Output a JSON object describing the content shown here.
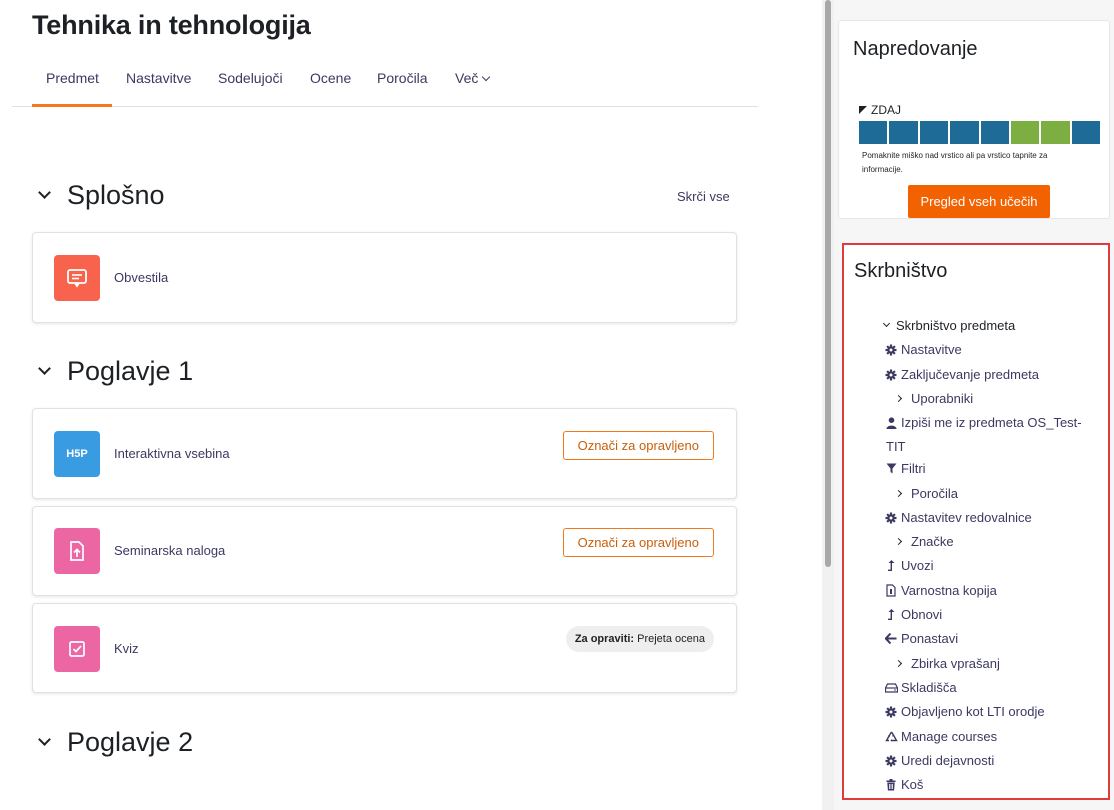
{
  "course": {
    "title": "Tehnika in tehnologija"
  },
  "tabs": [
    {
      "label": "Predmet",
      "active": true
    },
    {
      "label": "Nastavitve"
    },
    {
      "label": "Sodelujoči"
    },
    {
      "label": "Ocene"
    },
    {
      "label": "Poročila"
    },
    {
      "label": "Več"
    }
  ],
  "collapse_all": "Skrči vse",
  "sections": [
    {
      "title": "Splošno"
    },
    {
      "title": "Poglavje 1"
    },
    {
      "title": "Poglavje 2"
    }
  ],
  "activities": [
    {
      "name": "Obvestila",
      "icon": "forum-icon",
      "color": "#f7634d"
    },
    {
      "name": "Interaktivna vsebina",
      "icon": "h5p-icon",
      "color": "#399be2",
      "icon_text": "H5P",
      "action": "Označi za opravljeno"
    },
    {
      "name": "Seminarska naloga",
      "icon": "assignment-upload-icon",
      "color": "#eb66a2",
      "action": "Označi za opravljeno"
    },
    {
      "name": "Kviz",
      "icon": "quiz-check-icon",
      "color": "#eb66a2",
      "todo_label": "Za opraviti:",
      "todo_value": "Prejeta ocena"
    }
  ],
  "progress_block": {
    "title": "Napredovanje",
    "now_label": "ZDAJ",
    "cells": [
      "pending",
      "pending",
      "pending",
      "pending",
      "pending",
      "done",
      "done",
      "pending"
    ],
    "colors": {
      "pending": "#1f6b98",
      "done": "#7cae42"
    },
    "hint": "Pomaknite miško nad vrstico ali pa vrstico tapnite za informacije.",
    "button": "Pregled vseh učečih"
  },
  "admin_block": {
    "title": "Skrbništvo",
    "root": "Skrbništvo predmeta",
    "items": [
      {
        "label": "Nastavitve",
        "icon": "gear-icon"
      },
      {
        "label": "Zaključevanje predmeta",
        "icon": "gear-icon"
      },
      {
        "label": "Uporabniki",
        "icon": "chevron-right-icon"
      },
      {
        "label": "Izpiši me iz predmeta OS_Test-",
        "label2": "TIT",
        "icon": "user-icon"
      },
      {
        "label": "Filtri",
        "icon": "filter-icon"
      },
      {
        "label": "Poročila",
        "icon": "chevron-right-icon"
      },
      {
        "label": "Nastavitev redovalnice",
        "icon": "gear-icon"
      },
      {
        "label": "Značke",
        "icon": "chevron-right-icon"
      },
      {
        "label": "Uvozi",
        "icon": "import-icon"
      },
      {
        "label": "Varnostna kopija",
        "icon": "backup-file-icon"
      },
      {
        "label": "Obnovi",
        "icon": "restore-icon"
      },
      {
        "label": "Ponastavi",
        "icon": "arrow-left-icon"
      },
      {
        "label": "Zbirka vprašanj",
        "icon": "chevron-right-icon"
      },
      {
        "label": "Skladišča",
        "icon": "repository-icon"
      },
      {
        "label": "Objavljeno kot LTI orodje",
        "icon": "gear-icon"
      },
      {
        "label": "Manage courses",
        "icon": "recycle-icon"
      },
      {
        "label": "Uredi dejavnosti",
        "icon": "gear-icon"
      },
      {
        "label": "Koš",
        "icon": "trash-icon"
      }
    ]
  }
}
